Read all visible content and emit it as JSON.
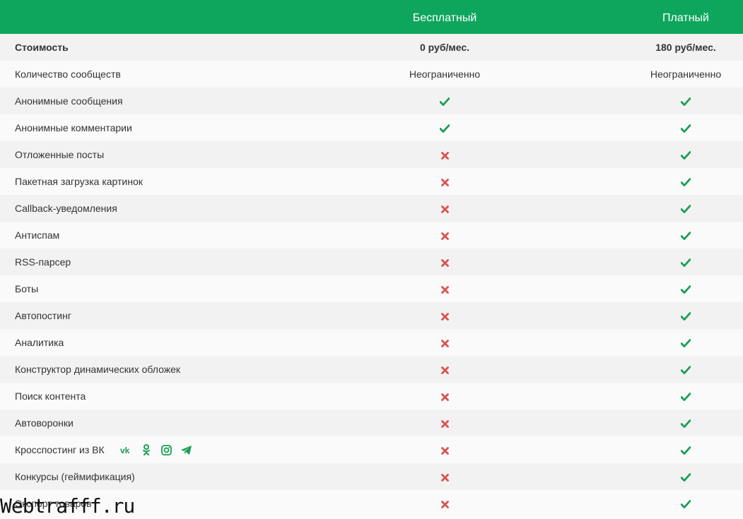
{
  "header": {
    "free_label": "Бесплатный",
    "paid_label": "Платный"
  },
  "rows": [
    {
      "label": "Стоимость",
      "free": "0 руб/мес.",
      "paid": "180 руб/мес.",
      "bold": true
    },
    {
      "label": "Количество сообществ",
      "free": "Неограниченно",
      "paid": "Неограниченно"
    },
    {
      "label": "Анонимные сообщения",
      "free": "check",
      "paid": "check"
    },
    {
      "label": "Анонимные комментарии",
      "free": "check",
      "paid": "check"
    },
    {
      "label": "Отложенные посты",
      "free": "cross",
      "paid": "check"
    },
    {
      "label": "Пакетная загрузка картинок",
      "free": "cross",
      "paid": "check"
    },
    {
      "label": "Callback-уведомления",
      "free": "cross",
      "paid": "check"
    },
    {
      "label": "Антиспам",
      "free": "cross",
      "paid": "check"
    },
    {
      "label": "RSS-парсер",
      "free": "cross",
      "paid": "check"
    },
    {
      "label": "Боты",
      "free": "cross",
      "paid": "check"
    },
    {
      "label": "Автопостинг",
      "free": "cross",
      "paid": "check"
    },
    {
      "label": "Аналитика",
      "free": "cross",
      "paid": "check"
    },
    {
      "label": "Конструктор динамических обложек",
      "free": "cross",
      "paid": "check"
    },
    {
      "label": "Поиск контента",
      "free": "cross",
      "paid": "check"
    },
    {
      "label": "Автоворонки",
      "free": "cross",
      "paid": "check"
    },
    {
      "label": "Кросспостинг из ВК",
      "free": "cross",
      "paid": "check",
      "social": [
        "vk-icon",
        "odnoklassniki-icon",
        "instagram-icon",
        "telegram-icon"
      ]
    },
    {
      "label": "Конкурсы (геймификация)",
      "free": "cross",
      "paid": "check"
    },
    {
      "label": "Экспорт товаров",
      "free": "cross",
      "paid": "check"
    }
  ],
  "colors": {
    "header_bg": "#0ea65d",
    "check": "#1a9e55",
    "cross": "#d9534f"
  },
  "watermark": "Webtrafff.ru"
}
